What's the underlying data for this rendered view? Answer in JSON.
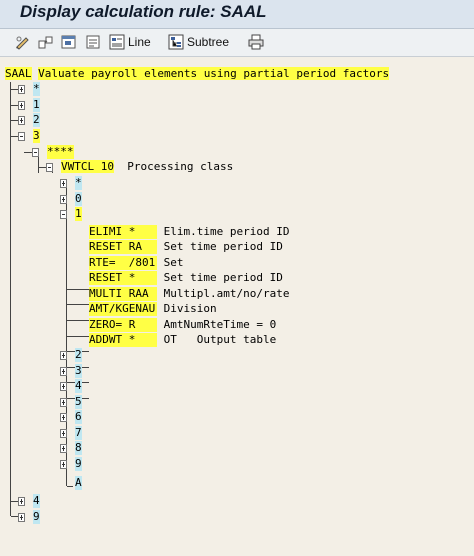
{
  "window": {
    "title": "Display calculation rule: SAAL"
  },
  "toolbar": {
    "icons": [
      "pencil-icon",
      "toggle-display-change-icon",
      "other-object-icon",
      "documentation-icon"
    ],
    "line_label": "Line",
    "subtree_label": "Subtree",
    "print_icon": "printer-icon"
  },
  "tree": {
    "root": {
      "name": "SAAL",
      "text": "Valuate payroll elements using partial period factors"
    },
    "rule_nodes": [
      "*",
      "1",
      "2",
      "3",
      "****",
      "4",
      "9"
    ],
    "operation": {
      "name": "VWTCL 10",
      "text": "Processing class"
    },
    "value_nodes": [
      "*",
      "0",
      "1",
      "2",
      "3",
      "4",
      "5",
      "6",
      "7",
      "8",
      "9",
      "A"
    ],
    "operations": [
      {
        "op": "ELIMI *",
        "text": "Elim.time period ID"
      },
      {
        "op": "RESET RA",
        "text": "Set time period ID"
      },
      {
        "op": "RTE=  /801",
        "text": "Set"
      },
      {
        "op": "RESET *",
        "text": "Set time period ID"
      },
      {
        "op": "MULTI RAA",
        "text": "Multipl.amt/no/rate"
      },
      {
        "op": "AMT/KGENAU",
        "text": "Division"
      },
      {
        "op": "ZERO= R",
        "text": "AmtNumRteTime = 0"
      },
      {
        "op": "ADDWT *",
        "text": "OT   Output table"
      }
    ]
  },
  "colors": {
    "highlight_yellow": "#ffff45",
    "highlight_cyan": "#bfe7f1",
    "tree_background": "#f3efe6",
    "titlebar": "#dbe4ee"
  }
}
